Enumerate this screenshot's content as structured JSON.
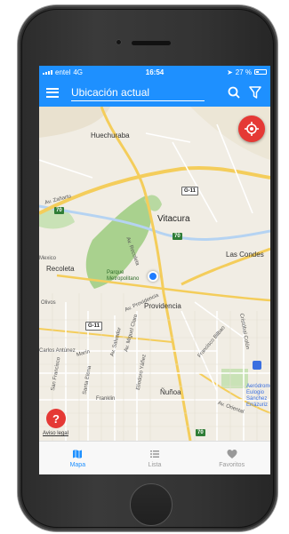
{
  "status_bar": {
    "carrier": "entel",
    "network": "4G",
    "time": "16:54",
    "battery": "27 %"
  },
  "header": {
    "search_placeholder": "Ubicación actual"
  },
  "map": {
    "places": [
      "Huechuraba",
      "Vitacura",
      "Las Condes",
      "Recoleta",
      "Parque Metropolitano",
      "Providencia",
      "Ñuñoa",
      "Aeródromo Eulogio Sánchez Errázuriz"
    ],
    "streets": [
      "Av. Zañartu",
      "Av. Recoleta",
      "Av. Providencia",
      "Av. Miguel Claro",
      "Av. Salvador",
      "Carlos Antúnez",
      "Marín",
      "Franklin",
      "San Francisco",
      "Santa Elena",
      "Av. Oriental",
      "Olivos",
      "Mexico",
      "Cristóbal Colón",
      "Francisco Bilbao",
      "Eliodoro Yáñez"
    ],
    "route_shields": [
      "70",
      "G-11",
      "70",
      "G-11",
      "70"
    ],
    "legal_link": "Aviso legal"
  },
  "tabs": [
    {
      "label": "Mapa",
      "icon": "map-icon",
      "active": true
    },
    {
      "label": "Lista",
      "icon": "list-icon",
      "active": false
    },
    {
      "label": "Favoritos",
      "icon": "heart-icon",
      "active": false
    }
  ],
  "colors": {
    "accent": "#1e90ff",
    "action_red": "#e53935",
    "park_green": "#a9d18e"
  }
}
